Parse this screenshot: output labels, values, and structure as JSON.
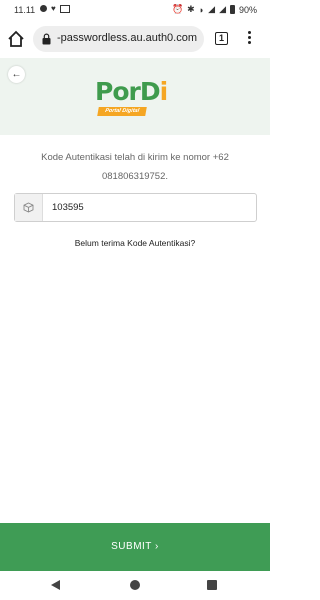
{
  "status_bar": {
    "time": "11.11",
    "battery": "90%"
  },
  "browser": {
    "url": "-passwordless.au.auth0.com",
    "tab_count": "1"
  },
  "header": {
    "back_icon": "arrow-left-icon",
    "logo_title_part1": "Por",
    "logo_title_part2": "D",
    "logo_title_part3": "i",
    "logo_tagline": "Portal Digital",
    "colors": {
      "brand_green": "#3f9b4d",
      "brand_orange": "#f5a623"
    }
  },
  "form": {
    "info_text": "Kode Autentikasi telah di kirim ke nomor +62 081806319752.",
    "otp_value": "103595",
    "otp_icon": "cube-icon",
    "resend_link": "Belum terima Kode Autentikasi?",
    "submit_label": "SUBMIT ›"
  }
}
